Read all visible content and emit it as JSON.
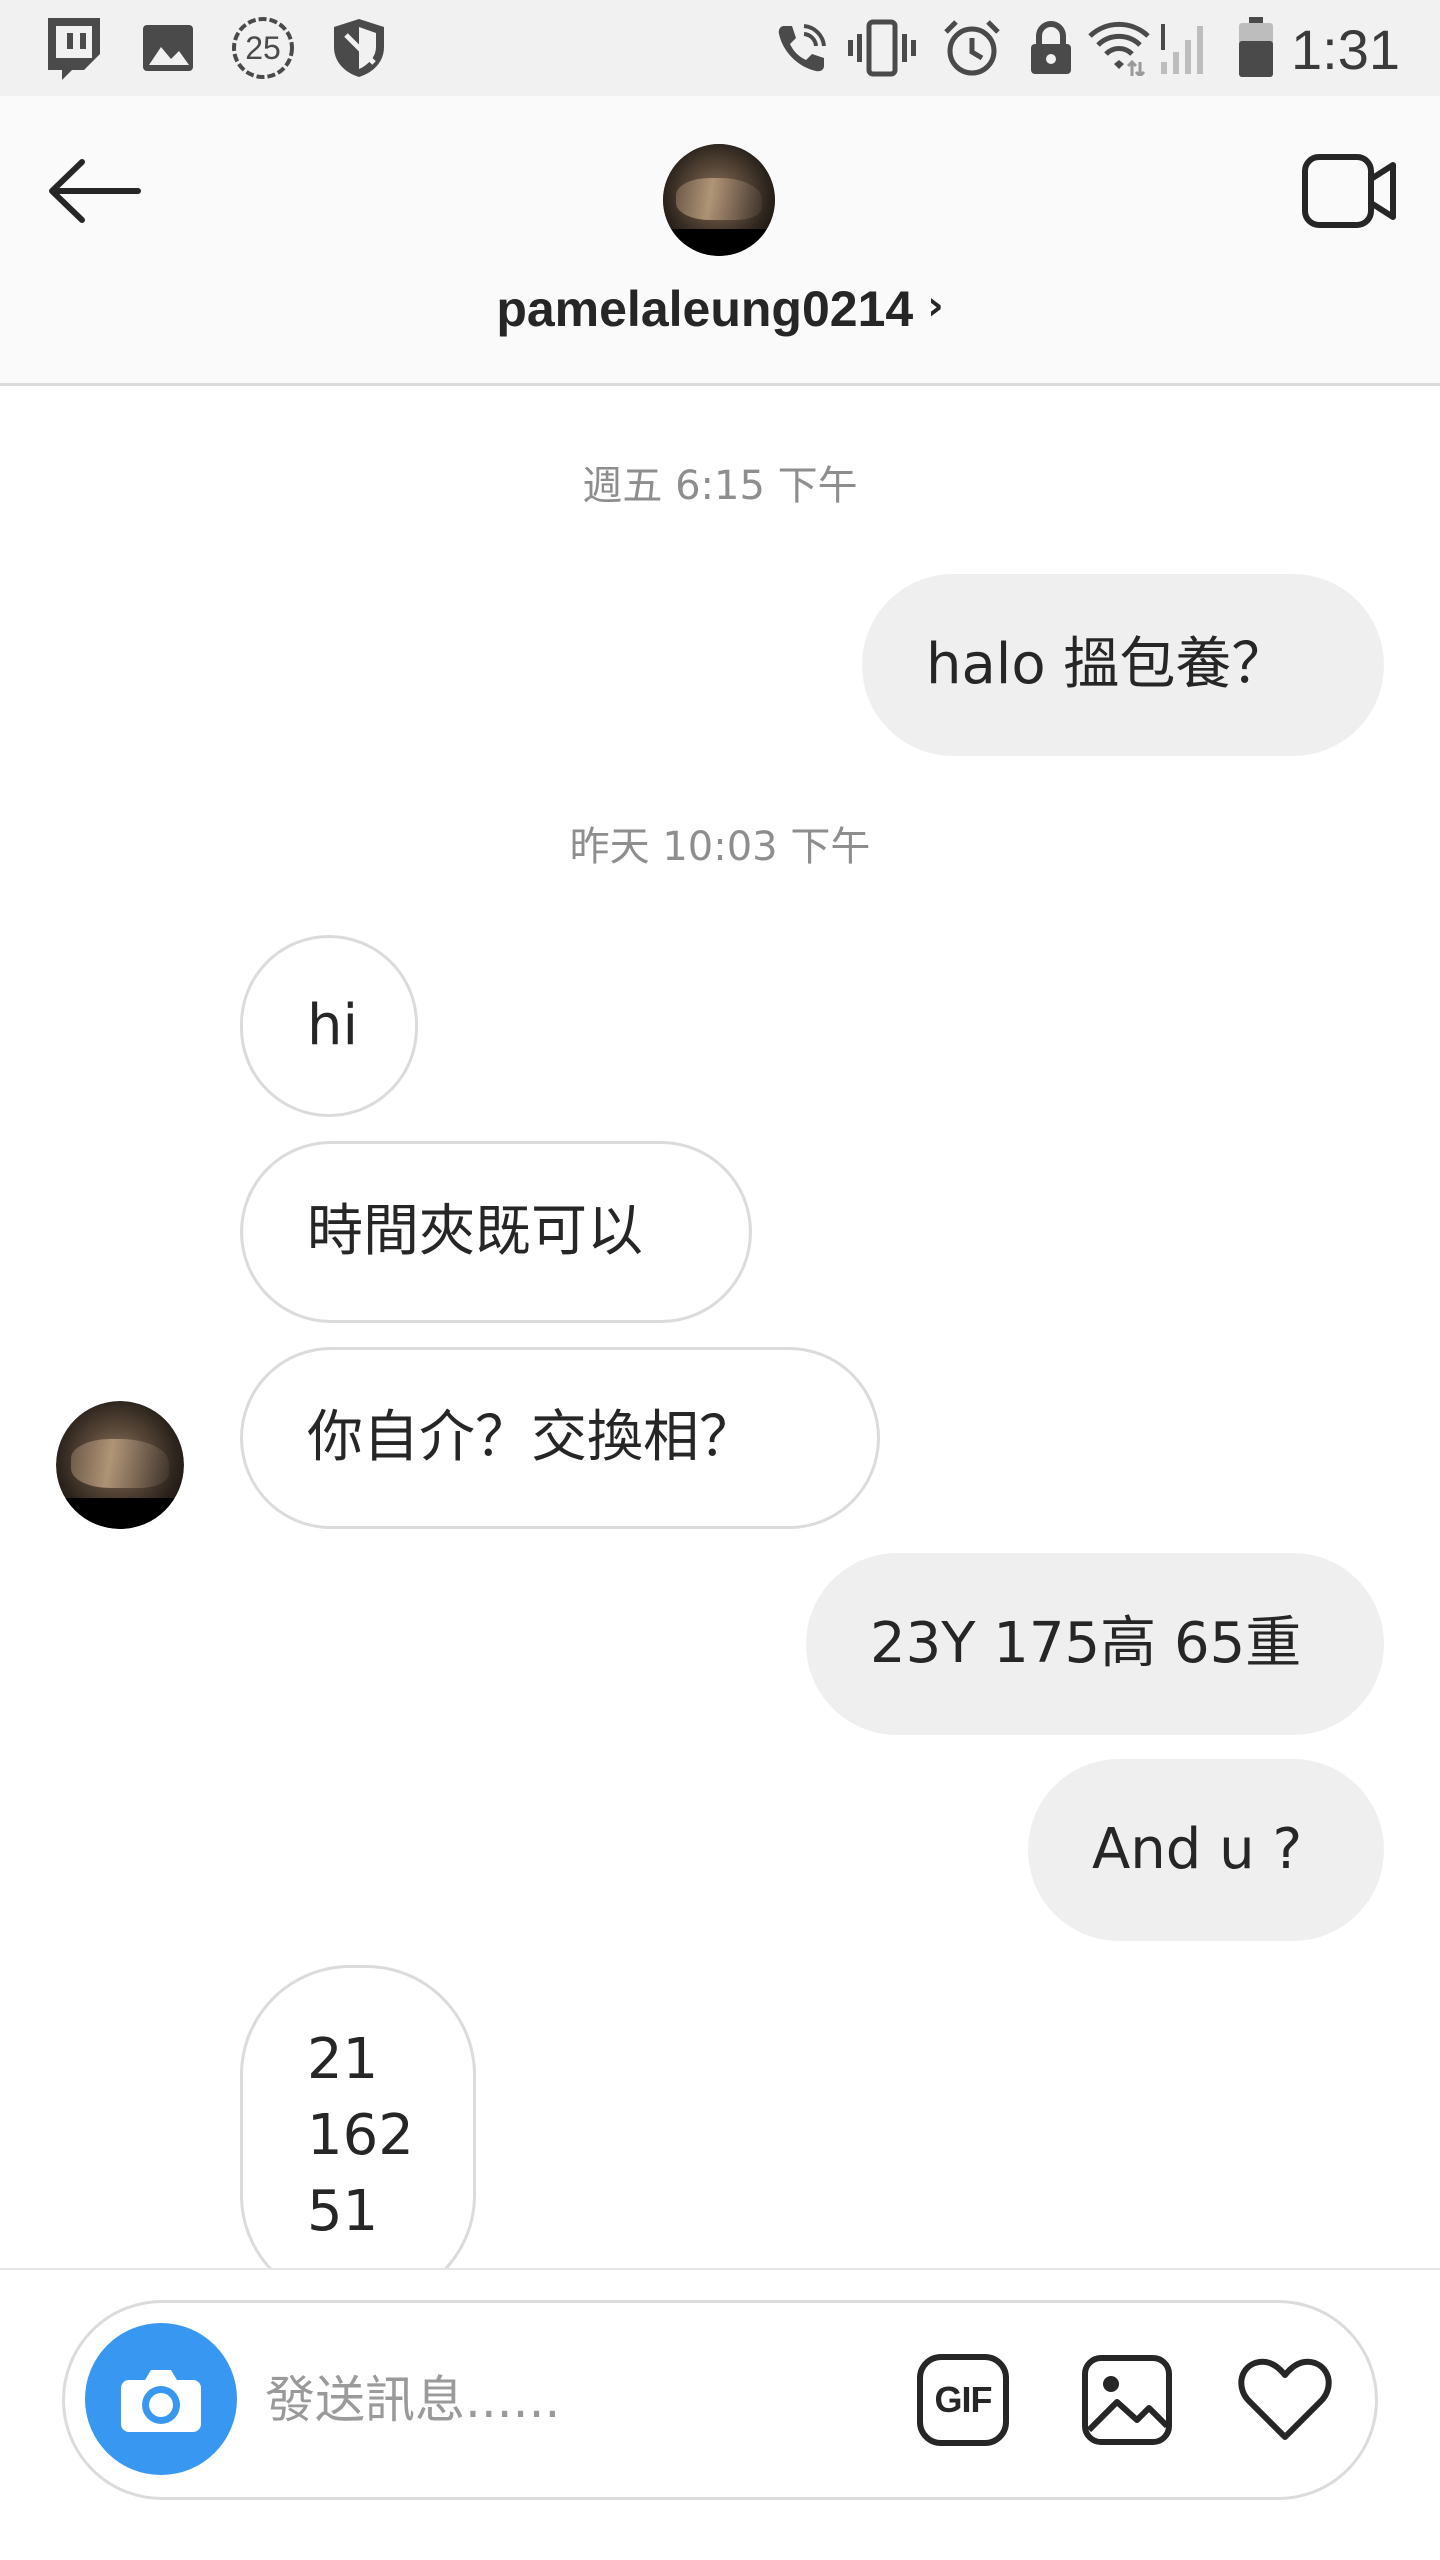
{
  "status_bar": {
    "time": "1:31",
    "notification_badge": "25",
    "icons": [
      "twitch-icon",
      "gallery-icon",
      "badge-25-icon",
      "shield-icon",
      "wifi-call-icon",
      "vibrate-icon",
      "alarm-icon",
      "lock-icon",
      "wifi-icon",
      "signal-icon",
      "battery-icon"
    ]
  },
  "header": {
    "username": "pamelaleung0214",
    "chevron": "›",
    "back_icon": "arrow-left-icon",
    "video_icon": "video-camera-icon"
  },
  "chat": {
    "timestamps": [
      "週五 6:15 下午",
      "昨天 10:03 下午"
    ],
    "messages": [
      {
        "dir": "out",
        "text": "halo 搵包養？"
      },
      {
        "dir": "in",
        "text": "hi"
      },
      {
        "dir": "in",
        "text": "時間夾既可以"
      },
      {
        "dir": "in",
        "text": "你自介？交換相？"
      },
      {
        "dir": "out",
        "text": "23Y 175高 65重"
      },
      {
        "dir": "out",
        "text": "And u ?"
      },
      {
        "dir": "in",
        "text": "21\n162\n51"
      }
    ]
  },
  "composer": {
    "placeholder": "發送訊息......",
    "gif_label": "GIF",
    "camera_icon": "camera-icon",
    "image_icon": "image-icon",
    "heart_icon": "heart-icon"
  },
  "colors": {
    "accent": "#3897f0",
    "bubble_out": "#efefef",
    "bubble_in_border": "#dbdbdb",
    "status_bar_bg": "#f1f1f1",
    "header_bg": "#fafafa",
    "timestamp": "#8e8e8e"
  }
}
